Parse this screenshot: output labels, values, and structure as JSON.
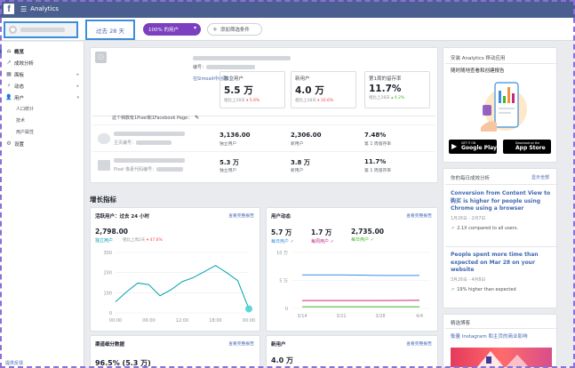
{
  "topbar": {
    "title": "Analytics",
    "logo": "f"
  },
  "filterbar": {
    "date_range": "过去 28 天",
    "segment": "100% 的用户",
    "add_filter": "添加筛选条件"
  },
  "sidebar": {
    "items": [
      {
        "label": "概览",
        "icon": "home-icon",
        "active": true,
        "arrow": false
      },
      {
        "label": "成效分析",
        "icon": "trend-icon",
        "arrow": false
      },
      {
        "label": "面板",
        "icon": "dashboard-icon",
        "arrow": true
      },
      {
        "label": "动态",
        "icon": "activity-icon",
        "arrow": true
      },
      {
        "label": "用户",
        "icon": "people-icon",
        "arrow": true
      }
    ],
    "sub_items": [
      "人口统计",
      "技术",
      "用户属性"
    ],
    "settings": "设置",
    "feedback": "提供反馈"
  },
  "summary": {
    "id_label": "编号：",
    "created_by": "在Simoait中创建",
    "metrics": [
      {
        "label": "独立用户",
        "value": "5.5 万",
        "cmp_text": "相比上28天",
        "change": "5.6%",
        "dir": "down"
      },
      {
        "label": "新用户",
        "value": "4.0 万",
        "cmp_text": "相比上28天",
        "change": "10.6%",
        "dir": "down"
      },
      {
        "label": "第1周的留存率",
        "value": "11.7%",
        "cmp_text": "相比上28天",
        "change": "4.2%",
        "dir": "up"
      }
    ],
    "connected_text": "这个档数有1Pixel和1Facebook Page：",
    "rows": [
      {
        "sub": "主页编号：",
        "v1": "3,136.00",
        "l1": "独立用户",
        "v2": "2,306.00",
        "l2": "新用户",
        "v3": "7.48%",
        "l3": "第 1 周留存率"
      },
      {
        "sub": "Pixel 像素代码编号：",
        "v1": "5.3 万",
        "l1": "独立用户",
        "v2": "3.8 万",
        "l2": "新用户",
        "v3": "11.7%",
        "l3": "第 1 周留存率"
      }
    ]
  },
  "growth": {
    "title": "增长指标"
  },
  "active_users": {
    "title": "活跃用户：过去 24 小时",
    "link": "查看完整报告",
    "value": "2,798.00",
    "legend": "独立用户",
    "cmp_text": "相比上周2天",
    "cmp_change": "47.6%",
    "ylabels": [
      "300",
      "200",
      "100",
      "0"
    ],
    "xlabels": [
      "00:00",
      "06:00",
      "12:00",
      "18:00",
      "00:00"
    ]
  },
  "user_activity": {
    "title": "用户动态",
    "link": "查看完整报告",
    "stats": [
      {
        "value": "5.7 万",
        "label": "每日用户",
        "color": "#3b8ddd"
      },
      {
        "value": "1.7 万",
        "label": "每周用户",
        "color": "#c62a80"
      },
      {
        "value": "2,735.00",
        "label": "每日用户",
        "color": "#42b72a"
      }
    ],
    "ylabels": [
      "10 万",
      "5 万",
      "0"
    ],
    "xlabels": [
      "3/14",
      "3/21",
      "3/28",
      "4/4"
    ]
  },
  "source": {
    "title": "渠道细分数据",
    "link": "查看完整报告",
    "value": "96.5% (5.3 万)"
  },
  "new_users": {
    "title": "新用户",
    "link": "查看完整报告",
    "value": "4.0 万"
  },
  "promo": {
    "title": "安装 Analytics 移动应用",
    "subtitle": "随时随地查看和创建报告",
    "google_small": "GET IT ON",
    "google": "Google Play",
    "apple_small": "Download on the",
    "apple": "App Store"
  },
  "daily": {
    "title": "你的每日成效分析",
    "see_all": "显示全部",
    "insights": [
      {
        "title": "Conversion from Content View to 购买 is higher for people using Chrome using a browser",
        "date": "1月26日 - 2月7日",
        "stat": "2.1X compared to all users."
      },
      {
        "title": "People spent more time than expected on Mar 28 on your website",
        "date": "3月26日 - 4月8日",
        "stat": "19% higher than expected"
      }
    ]
  },
  "featured": {
    "title": "精选博客",
    "post": "衡量 Instagram 和主页的商业影响"
  },
  "chart_data": [
    {
      "type": "line",
      "title": "活跃用户：过去 24 小时",
      "x": [
        "00:00",
        "02:00",
        "04:00",
        "06:00",
        "08:00",
        "10:00",
        "12:00",
        "14:00",
        "16:00",
        "18:00",
        "20:00",
        "22:00",
        "00:00"
      ],
      "series": [
        {
          "name": "独立用户",
          "values": [
            55,
            105,
            148,
            140,
            85,
            115,
            155,
            175,
            205,
            235,
            200,
            160,
            20
          ]
        }
      ],
      "ylim": [
        0,
        300
      ],
      "xlabel": "",
      "ylabel": ""
    },
    {
      "type": "line",
      "title": "用户动态",
      "x": [
        "3/14",
        "3/21",
        "3/28",
        "4/4"
      ],
      "series": [
        {
          "name": "每日用户",
          "values": [
            60000,
            60000,
            59000,
            59000
          ]
        },
        {
          "name": "每周用户",
          "values": [
            14000,
            14000,
            14000,
            14500
          ]
        },
        {
          "name": "每日用户",
          "values": [
            3000,
            3000,
            3000,
            3000
          ]
        }
      ],
      "ylim": [
        0,
        100000
      ],
      "xlabel": "",
      "ylabel": ""
    }
  ]
}
